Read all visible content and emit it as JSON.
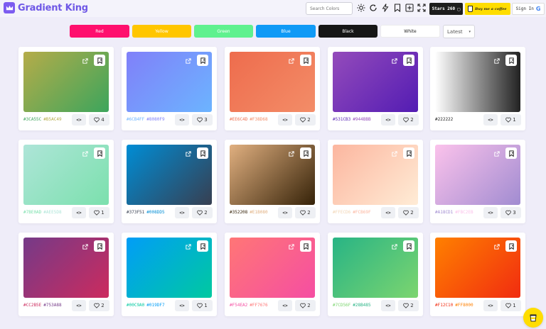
{
  "header": {
    "logo_text": "Gradient King",
    "search_placeholder": "Search Colors",
    "stars_label": "Stars 260",
    "coffee_label": "Buy me a coffee",
    "signin_label": "Sign In",
    "signin_icon": "G"
  },
  "filters": {
    "red": "Red",
    "yellow": "Yellow",
    "green": "Green",
    "blue": "Blue",
    "black": "Black",
    "white": "White"
  },
  "sort": {
    "selected": "Latest"
  },
  "code_icon_label": "<>",
  "cards": [
    {
      "codes": [
        "#3CA55C",
        "#B5AC49"
      ],
      "likes": "4"
    },
    {
      "codes": [
        "#6CB4FF",
        "#8080F9"
      ],
      "likes": "3"
    },
    {
      "codes": [
        "#EE6C4D",
        "#F38D68"
      ],
      "likes": "2"
    },
    {
      "codes": [
        "#531CB3",
        "#944BBB"
      ],
      "likes": "2"
    },
    {
      "codes": [
        "#222222"
      ],
      "likes": "1"
    },
    {
      "codes": [
        "#7BE0AD",
        "#AEE5D8"
      ],
      "likes": "1"
    },
    {
      "codes": [
        "#373F51",
        "#008DD5"
      ],
      "likes": "2"
    },
    {
      "codes": [
        "#352208",
        "#E1B080"
      ],
      "likes": "2"
    },
    {
      "codes": [
        "#FFECD6",
        "#FCB69F"
      ],
      "likes": "2"
    },
    {
      "codes": [
        "#A18CD1",
        "#FBC2EB"
      ],
      "likes": "3"
    },
    {
      "codes": [
        "#CC2B5E",
        "#753A88"
      ],
      "likes": "2"
    },
    {
      "codes": [
        "#00C9A0",
        "#019DF7"
      ],
      "likes": "1"
    },
    {
      "codes": [
        "#F54EA2",
        "#FF7676"
      ],
      "likes": "2"
    },
    {
      "codes": [
        "#7CD56F",
        "#28B485"
      ],
      "likes": "2"
    },
    {
      "codes": [
        "#F12C10",
        "#FF8000"
      ],
      "likes": "1"
    }
  ]
}
